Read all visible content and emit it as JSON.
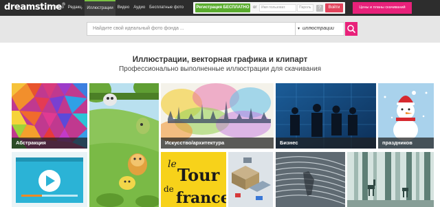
{
  "header": {
    "logo_text": "dreamstime",
    "logo_mark": "®",
    "nav": [
      {
        "label": "Фото"
      },
      {
        "label": "Редакц."
      },
      {
        "label": "Иллюстрации",
        "active": true
      },
      {
        "label": "Видео"
      },
      {
        "label": "Аудио"
      },
      {
        "label": "Бесплатные фото"
      }
    ],
    "register_label": "Регистрация БЕСПЛАТНО",
    "or_label": "or",
    "username_placeholder": "Имя пользоват.",
    "password_placeholder": "Пароль",
    "help_label": "?",
    "login_label": "Войти",
    "pricing_label": "Цены и планы скачиваний",
    "accent_color": "#e8217a",
    "register_color": "#5aac2e"
  },
  "search": {
    "placeholder": "Найдите свой идеальный фото фонда ...",
    "type_value": "иллюстрации"
  },
  "main": {
    "title": "Иллюстрации, векторная графика и клипарт",
    "subtitle": "Профессионально выполненные иллюстрации для скачивания"
  },
  "tiles": [
    {
      "label": "Абстракция"
    },
    {
      "label": ""
    },
    {
      "label": "Искусство/архитектура"
    },
    {
      "label": "Бизнес"
    },
    {
      "label": "праздников"
    },
    {
      "label": ""
    },
    {
      "label": ""
    },
    {
      "label": ""
    },
    {
      "label": ""
    },
    {
      "label": ""
    }
  ]
}
